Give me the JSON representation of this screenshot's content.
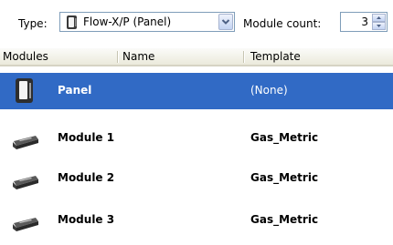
{
  "toolbar": {
    "type_label": "Type:",
    "type_value": "Flow-X/P (Panel)",
    "module_count_label": "Module count:",
    "module_count_value": "3"
  },
  "columns": [
    "Modules",
    "Name",
    "Template"
  ],
  "rows": [
    {
      "name": "Panel",
      "template": "(None)",
      "icon": "panel-device-icon",
      "selected": true
    },
    {
      "name": "Module 1",
      "template": "Gas_Metric",
      "icon": "module-device-icon",
      "selected": false
    },
    {
      "name": "Module 2",
      "template": "Gas_Metric",
      "icon": "module-device-icon",
      "selected": false
    },
    {
      "name": "Module 3",
      "template": "Gas_Metric",
      "icon": "module-device-icon",
      "selected": false
    }
  ],
  "colors": {
    "selection": "#316ac5",
    "header_bg": "#ebeadb",
    "border": "#7f9db9"
  }
}
